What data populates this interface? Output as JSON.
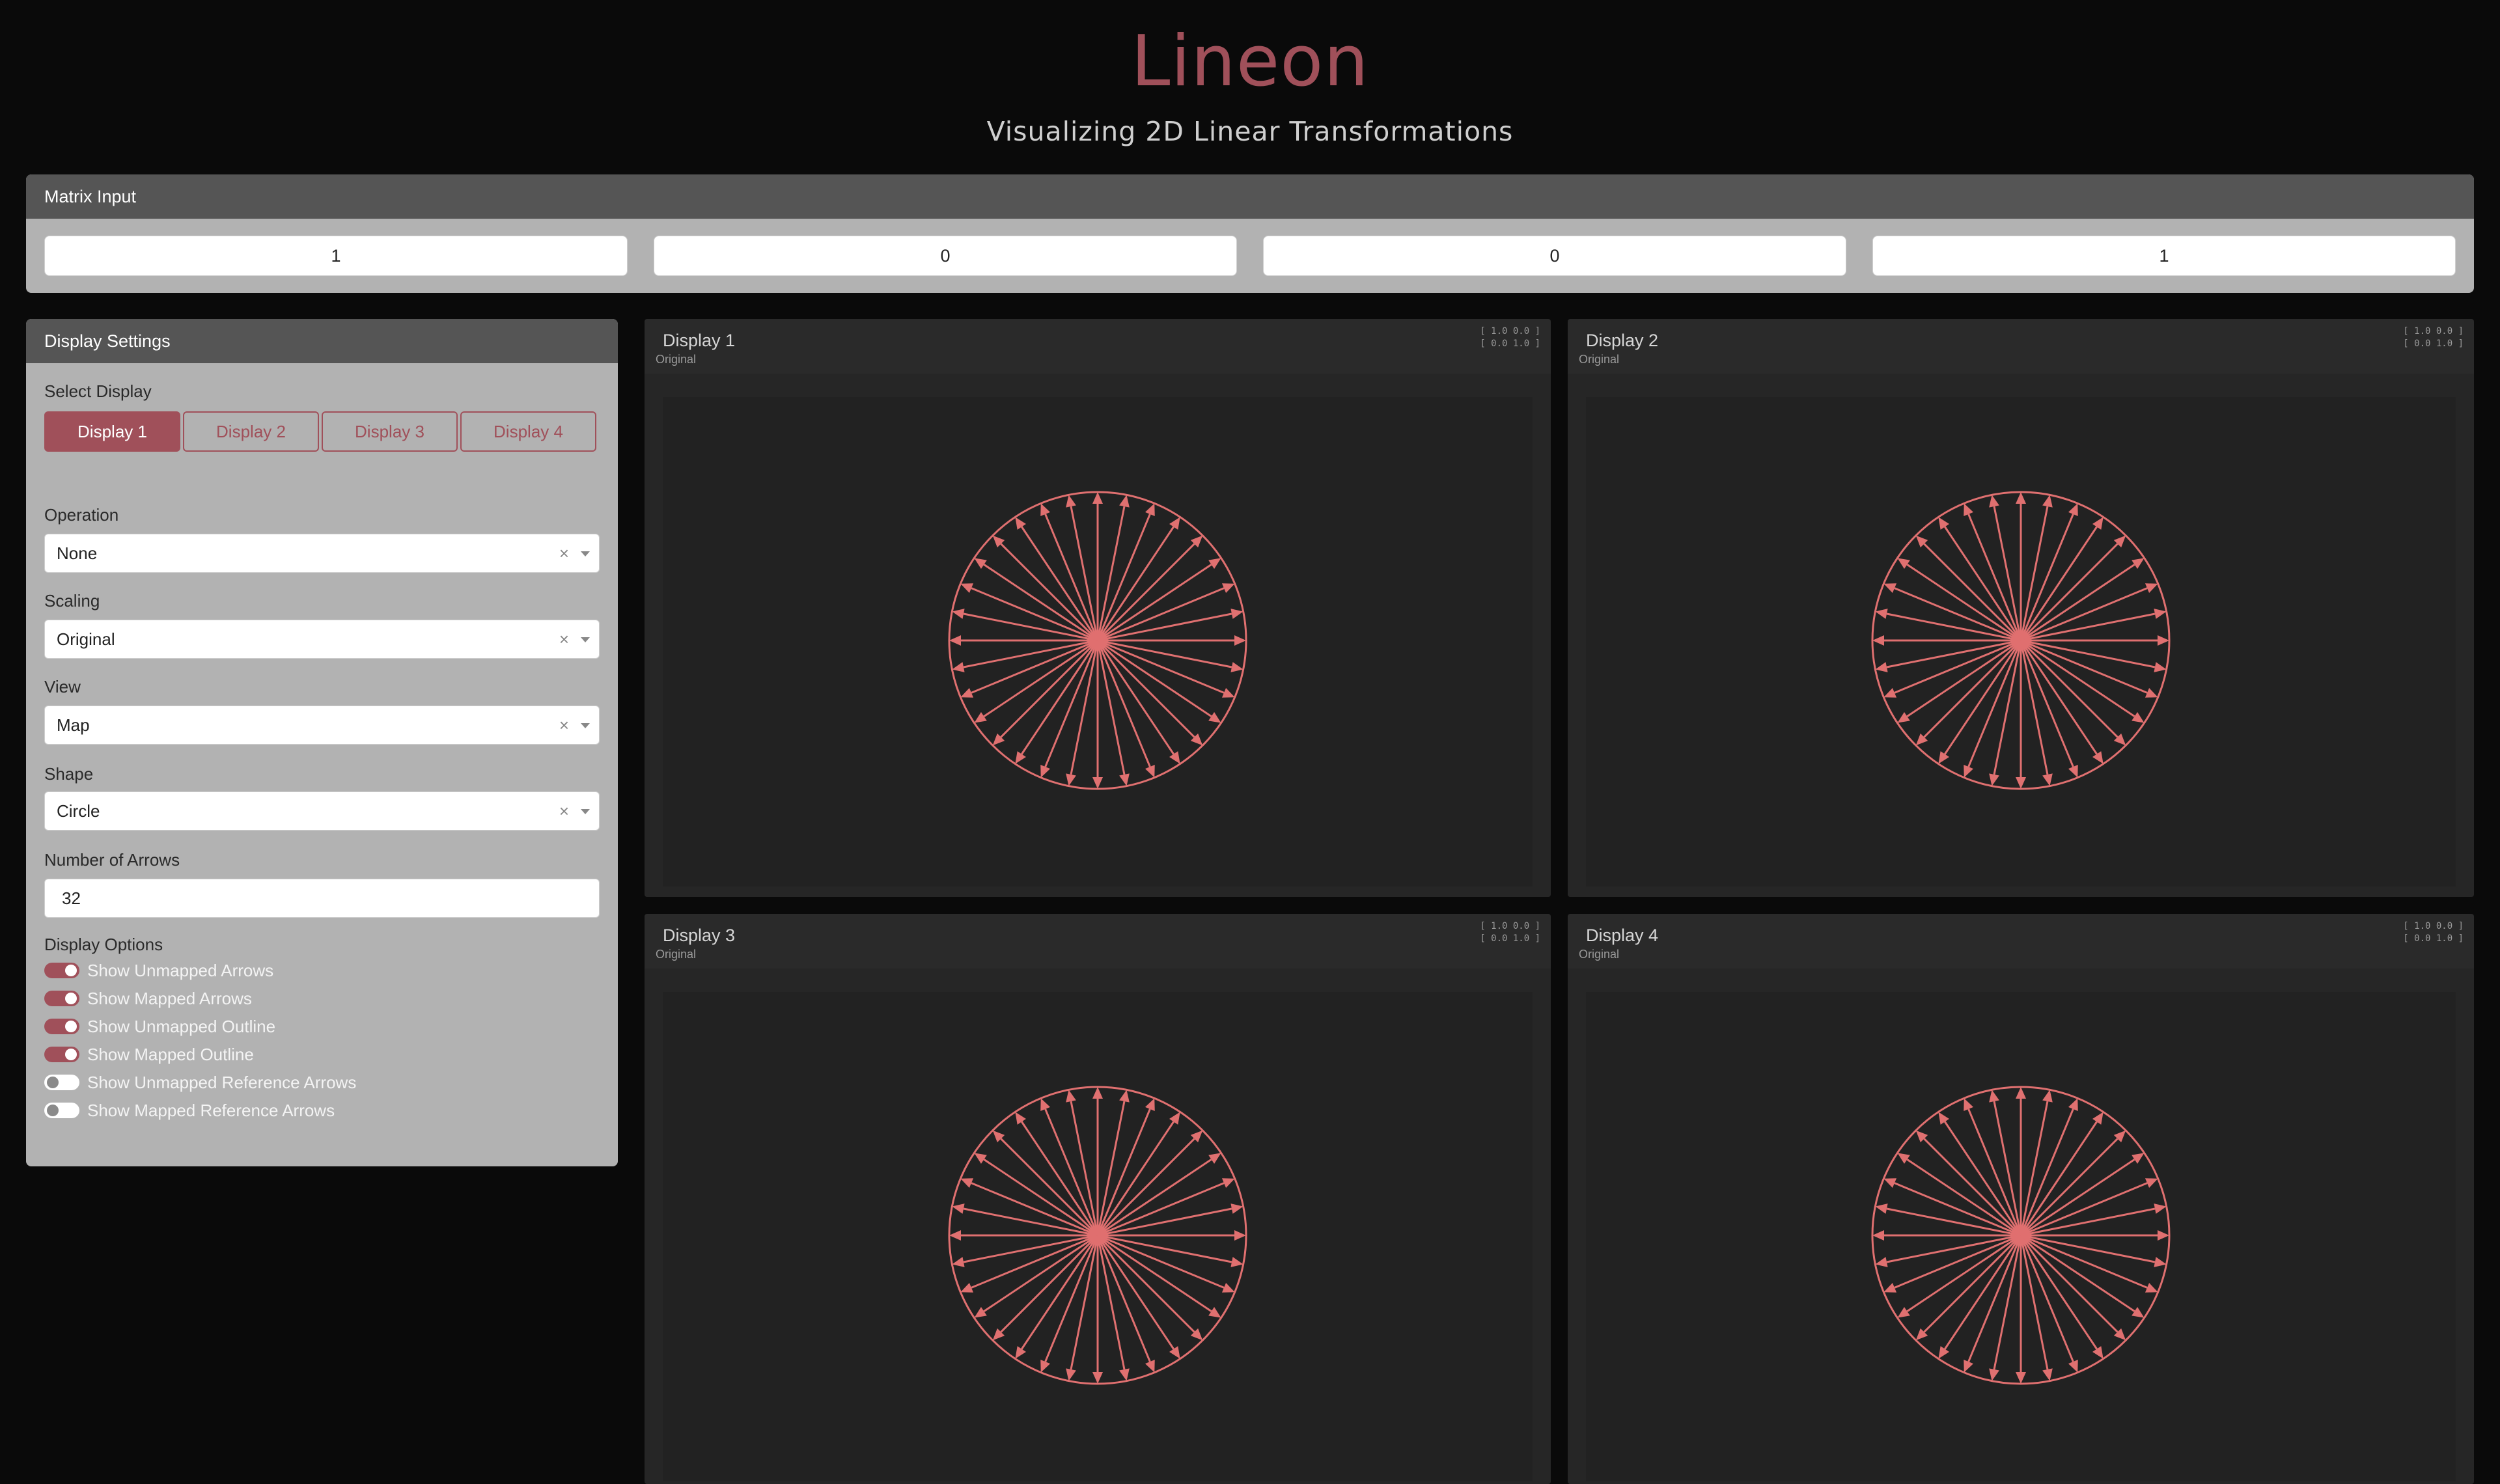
{
  "header": {
    "title": "Lineon",
    "subtitle": "Visualizing 2D Linear Transformations"
  },
  "matrix_input": {
    "label": "Matrix Input",
    "values": [
      "1",
      "0",
      "0",
      "1"
    ]
  },
  "settings": {
    "title": "Display Settings",
    "select_display_label": "Select Display",
    "display_buttons": [
      "Display 1",
      "Display 2",
      "Display 3",
      "Display 4"
    ],
    "active_display": "Display 1",
    "operation": {
      "label": "Operation",
      "value": "None"
    },
    "scaling": {
      "label": "Scaling",
      "value": "Original"
    },
    "view": {
      "label": "View",
      "value": "Map"
    },
    "shape": {
      "label": "Shape",
      "value": "Circle"
    },
    "arrows": {
      "label": "Number of Arrows",
      "value": "32"
    },
    "options_label": "Display Options",
    "options": [
      {
        "label": "Show Unmapped Arrows",
        "on": true
      },
      {
        "label": "Show Mapped Arrows",
        "on": true
      },
      {
        "label": "Show Unmapped Outline",
        "on": true
      },
      {
        "label": "Show Mapped Outline",
        "on": true
      },
      {
        "label": "Show Unmapped Reference Arrows",
        "on": false
      },
      {
        "label": "Show Mapped Reference Arrows",
        "on": false
      }
    ],
    "clear_glyph": "×"
  },
  "displays": [
    {
      "title": "Display 1",
      "scaling": "Original",
      "matrix_row1": "[ 1.0 0.0 ]",
      "matrix_row2": "[ 0.0 1.0 ]"
    },
    {
      "title": "Display 2",
      "scaling": "Original",
      "matrix_row1": "[ 1.0 0.0 ]",
      "matrix_row2": "[ 0.0 1.0 ]"
    },
    {
      "title": "Display 3",
      "scaling": "Original",
      "matrix_row1": "[ 1.0 0.0 ]",
      "matrix_row2": "[ 0.0 1.0 ]"
    },
    {
      "title": "Display 4",
      "scaling": "Original",
      "matrix_row1": "[ 1.0 0.0 ]",
      "matrix_row2": "[ 0.0 1.0 ]"
    }
  ],
  "colors": {
    "accent": "#a0505a",
    "arrow": "#e07070",
    "panel": "#b2b2b2",
    "header": "#555555"
  }
}
